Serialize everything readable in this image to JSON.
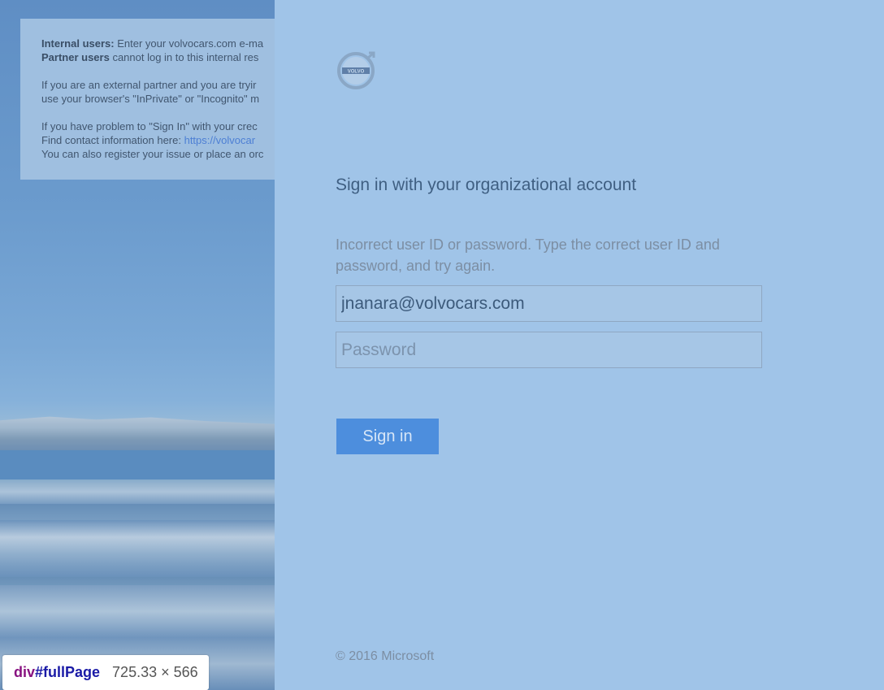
{
  "notice": {
    "line1_bold": "Internal users:",
    "line1_text": " Enter your volvocars.com e-ma",
    "line2_bold": "Partner users",
    "line2_text": " cannot log in to this internal res",
    "line3": "If you are an external partner and you are tryir",
    "line4": "use your browser's \"InPrivate\" or \"Incognito\" m",
    "line5": "If you have problem to \"Sign In\" with your crec",
    "line6_text": "Find contact information here: ",
    "line6_link": "https://volvocar",
    "line7": "You can also register your issue or place an orc"
  },
  "logo": {
    "icon": "volvo-logo",
    "text": "VOLVO"
  },
  "signin": {
    "title": "Sign in with your organizational account",
    "error": "Incorrect user ID or password. Type the correct user ID and password, and try again.",
    "username_value": "jnanara@volvocars.com",
    "password_placeholder": "Password",
    "button_label": "Sign in",
    "footer": "© 2016 Microsoft"
  },
  "devtools_tooltip": {
    "tag": "div",
    "selector": "#fullPage",
    "dimensions": "725.33 × 566"
  },
  "colors": {
    "panel_bg": "#a0c4e8",
    "button_bg": "#4d8edd",
    "title_text": "#3f5f82",
    "error_text": "#7c8ea3"
  }
}
